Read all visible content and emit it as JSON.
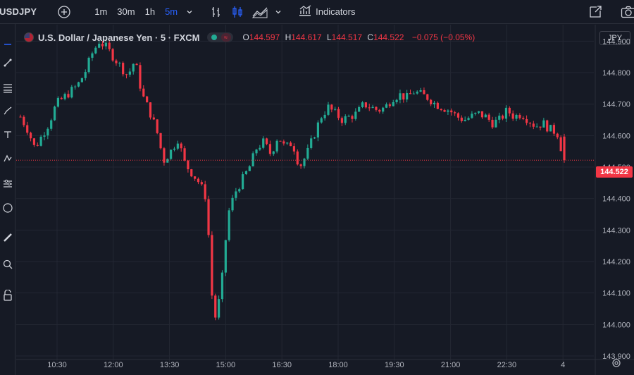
{
  "toolbar": {
    "symbol": "USDJPY",
    "intervals": [
      "1m",
      "30m",
      "1h",
      "5m"
    ],
    "active_interval": "5m",
    "indicators_label": "Indicators"
  },
  "legend": {
    "title": "U.S. Dollar / Japanese Yen · 5 · FXCM",
    "o_key": "O",
    "o_val": "144.597",
    "h_key": "H",
    "h_val": "144.617",
    "l_key": "L",
    "l_val": "144.517",
    "c_key": "C",
    "c_val": "144.522",
    "change": "−0.075 (−0.05%)"
  },
  "currency_badge": "JPY",
  "last_price_tag": "144.522",
  "colors": {
    "background": "#161a25",
    "grid": "#232733",
    "up": "#22ab94",
    "down": "#f23645",
    "text": "#b2b5be"
  },
  "chart_data": {
    "type": "candlestick",
    "y_ticks": [
      "144.900",
      "144.800",
      "144.700",
      "144.600",
      "144.500",
      "144.400",
      "144.300",
      "144.200",
      "144.100",
      "144.000",
      "143.900"
    ],
    "x_ticks": [
      "10:30",
      "12:00",
      "13:30",
      "15:00",
      "16:30",
      "18:00",
      "19:30",
      "21:00",
      "22:30",
      "4"
    ],
    "ylim": [
      143.9,
      144.93
    ],
    "last_price": 144.522,
    "close_path": [
      144.66,
      144.62,
      144.56,
      144.6,
      144.64,
      144.7,
      144.72,
      144.74,
      144.76,
      144.8,
      144.86,
      144.9,
      144.88,
      144.85,
      144.82,
      144.79,
      144.84,
      144.73,
      144.68,
      144.62,
      144.52,
      144.55,
      144.59,
      144.51,
      144.48,
      144.45,
      144.4,
      144.0,
      144.1,
      144.35,
      144.42,
      144.46,
      144.5,
      144.56,
      144.58,
      144.54,
      144.6,
      144.56,
      144.58,
      144.5,
      144.54,
      144.6,
      144.66,
      144.69,
      144.67,
      144.65,
      144.66,
      144.67,
      144.7,
      144.69,
      144.68,
      144.69,
      144.72,
      144.73,
      144.72,
      144.74,
      144.73,
      144.72,
      144.7,
      144.69,
      144.68,
      144.66,
      144.65,
      144.66,
      144.67,
      144.66,
      144.64,
      144.65,
      144.68,
      144.66,
      144.67,
      144.65,
      144.63,
      144.64,
      144.62,
      144.61,
      144.52
    ]
  }
}
